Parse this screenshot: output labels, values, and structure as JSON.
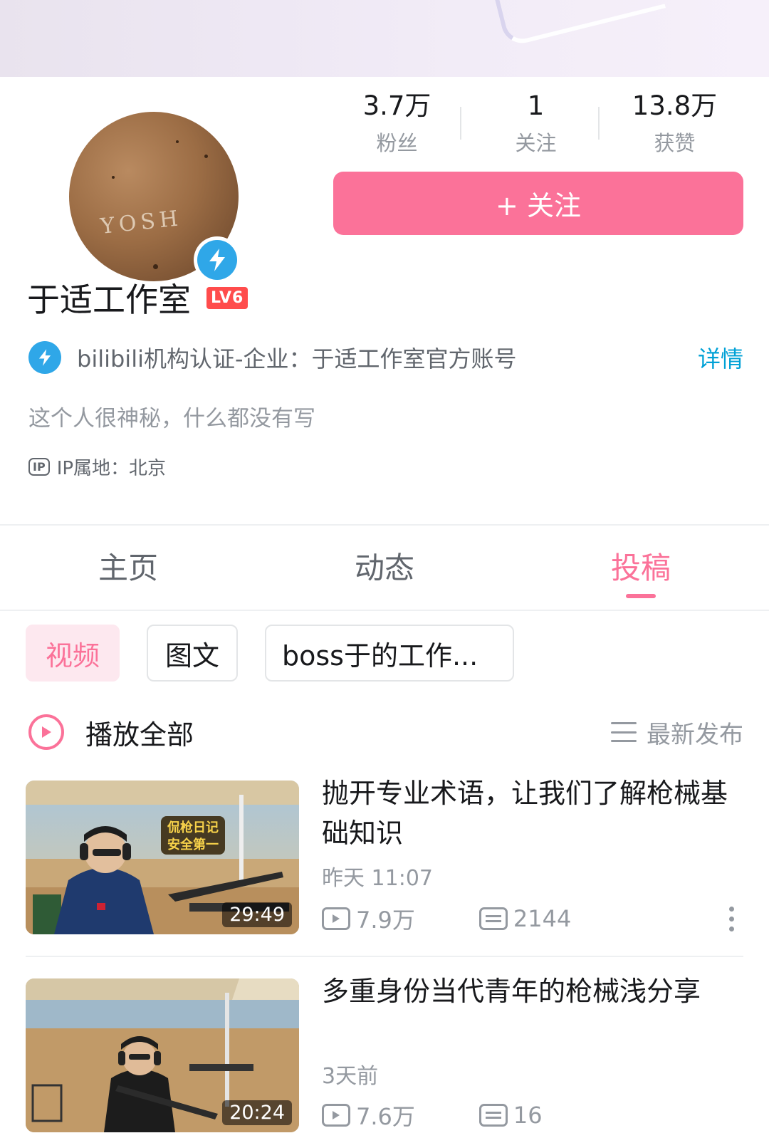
{
  "profile": {
    "name": "于适工作室",
    "level": "LV6",
    "stats": [
      {
        "value": "3.7万",
        "label": "粉丝"
      },
      {
        "value": "1",
        "label": "关注"
      },
      {
        "value": "13.8万",
        "label": "获赞"
      }
    ],
    "follow_label": "+ 关注",
    "certification": "bilibili机构认证-企业：于适工作室官方账号",
    "detail_link": "详情",
    "bio": "这个人很神秘，什么都没有写",
    "ip_tag": "IP",
    "ip_location": "IP属地：北京",
    "avatar_text": "YOSH"
  },
  "tabs": [
    {
      "label": "主页",
      "active": false
    },
    {
      "label": "动态",
      "active": false
    },
    {
      "label": "投稿",
      "active": true
    }
  ],
  "chips": [
    {
      "label": "视频",
      "active": true
    },
    {
      "label": "图文",
      "active": false
    },
    {
      "label": "boss于的工作...",
      "active": false
    }
  ],
  "list_header": {
    "play_all": "播放全部",
    "sort_label": "最新发布"
  },
  "videos": [
    {
      "title": "抛开专业术语，让我们了解枪械基础知识",
      "time": "昨天 11:07",
      "plays": "7.9万",
      "danmaku": "2144",
      "duration": "29:49",
      "thumb_caption": "侃枪日记 安全第一"
    },
    {
      "title": "多重身份当代青年的枪械浅分享",
      "time": "3天前",
      "plays": "7.6万",
      "danmaku": "16",
      "duration": "20:24"
    }
  ],
  "colors": {
    "accent": "#fb7299",
    "link": "#00a1d6",
    "verify": "#2fa7e8",
    "level": "#ff4c4c"
  }
}
